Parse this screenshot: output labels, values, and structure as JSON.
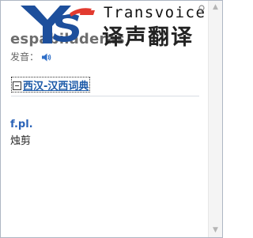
{
  "entry": {
    "headword": "espabiladeras",
    "pronunciation_label": "发音：",
    "dictionary_title": "西汉-汉西词典",
    "part_of_speech": "f.pl.",
    "meaning": "烛剪"
  },
  "brand": {
    "english": "Transvoice",
    "chinese": "译声翻译",
    "logo_letters": "YS",
    "logo_colors": {
      "blue": "#1d4f9c",
      "red": "#e23a2f"
    }
  },
  "controls": {
    "close_label": "×"
  },
  "scrollbar": {
    "up_arrow": "▲",
    "down_arrow": "▼"
  },
  "icons": [
    "speaker-icon",
    "collapse-icon",
    "pin-icon",
    "close-icon",
    "scroll-up-icon",
    "scroll-down-icon"
  ]
}
